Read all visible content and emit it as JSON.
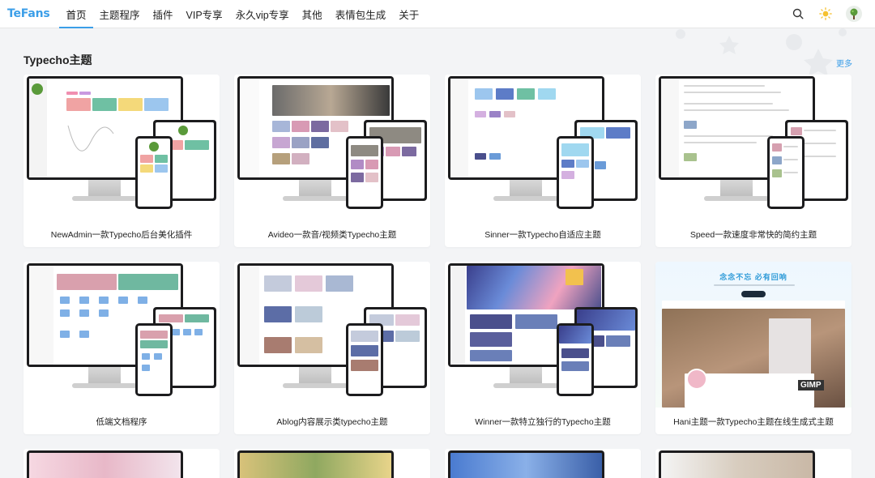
{
  "brand": {
    "logo": "TeFans",
    "accent": "#3b9ee8"
  },
  "nav": {
    "items": [
      {
        "label": "首页",
        "active": true
      },
      {
        "label": "主题程序"
      },
      {
        "label": "插件"
      },
      {
        "label": "VIP专享"
      },
      {
        "label": "永久vip专享"
      },
      {
        "label": "其他"
      },
      {
        "label": "表情包生成"
      },
      {
        "label": "关于"
      }
    ],
    "icons": [
      "search-icon",
      "sun-icon",
      "avatar"
    ]
  },
  "section": {
    "title": "Typecho主题",
    "more": "更多"
  },
  "cards": [
    {
      "title": "NewAdmin一款Typecho后台美化插件",
      "theme": "newadmin"
    },
    {
      "title": "Avideo一款音/视频类Typecho主题",
      "theme": "avideo"
    },
    {
      "title": "Sinner一款Typecho自适应主题",
      "theme": "sinner"
    },
    {
      "title": "Speed一款速度非常快的简约主题",
      "theme": "speed"
    },
    {
      "title": "低端文档程序",
      "theme": "docs"
    },
    {
      "title": "Ablog内容展示类typecho主题",
      "theme": "ablog"
    },
    {
      "title": "Winner一款特立独行的Typecho主题",
      "theme": "winner"
    },
    {
      "title": "Hani主题一款Typecho主题在线生成式主题",
      "theme": "hani"
    }
  ],
  "hani_preview": {
    "headline": "念念不忘 必有回响",
    "brand_label": "GIMP"
  }
}
